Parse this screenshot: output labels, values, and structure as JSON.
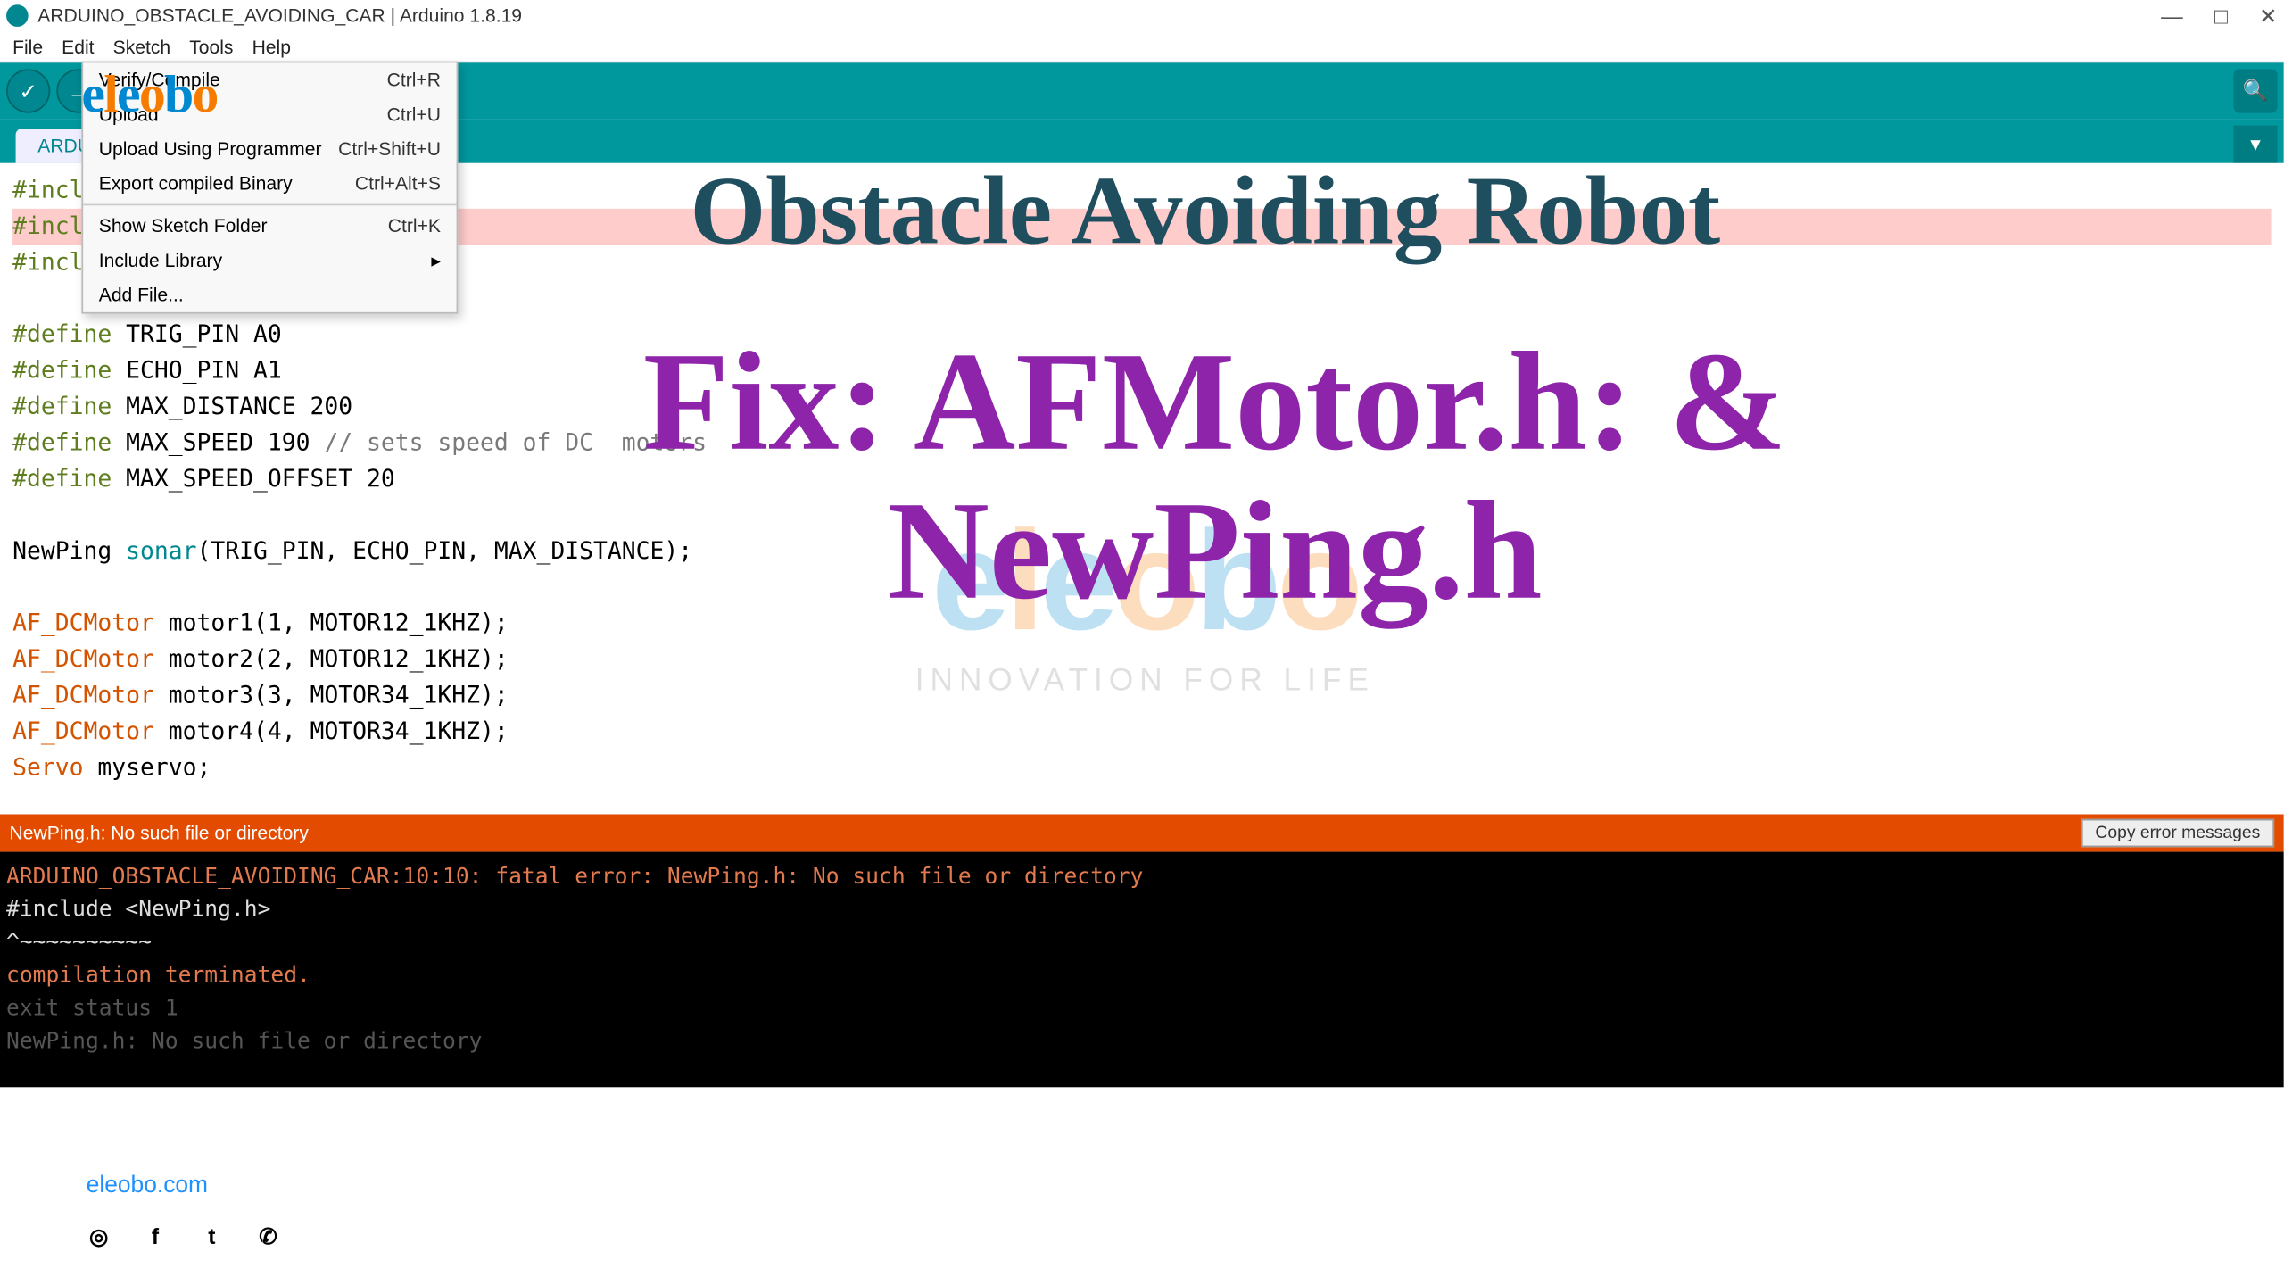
{
  "window": {
    "title": "ARDUINO_OBSTACLE_AVOIDING_CAR | Arduino 1.8.19"
  },
  "menubar": {
    "items": [
      "File",
      "Edit",
      "Sketch",
      "Tools",
      "Help"
    ]
  },
  "tab": {
    "name": "ARDUI"
  },
  "dropdown": {
    "items": [
      {
        "label": "Verify/Compile",
        "shortcut": "Ctrl+R"
      },
      {
        "label": "Upload",
        "shortcut": "Ctrl+U"
      },
      {
        "label": "Upload Using Programmer",
        "shortcut": "Ctrl+Shift+U"
      },
      {
        "label": "Export compiled Binary",
        "shortcut": "Ctrl+Alt+S"
      },
      {
        "label": "Show Sketch Folder",
        "shortcut": "Ctrl+K"
      },
      {
        "label": "Include Library",
        "shortcut": "",
        "submenu": true
      },
      {
        "label": "Add File...",
        "shortcut": ""
      }
    ]
  },
  "code": {
    "lines": [
      "#include",
      "#include <NewPing.h>",
      "#include <Servo.h>",
      "",
      "#define TRIG_PIN A0",
      "#define ECHO_PIN A1",
      "#define MAX_DISTANCE 200",
      "#define MAX_SPEED 190 // sets speed of DC  motors",
      "#define MAX_SPEED_OFFSET 20",
      "",
      "NewPing sonar(TRIG_PIN, ECHO_PIN, MAX_DISTANCE);",
      "",
      "AF_DCMotor motor1(1, MOTOR12_1KHZ);",
      "AF_DCMotor motor2(2, MOTOR12_1KHZ);",
      "AF_DCMotor motor3(3, MOTOR34_1KHZ);",
      "AF_DCMotor motor4(4, MOTOR34_1KHZ);",
      "Servo myservo;"
    ]
  },
  "status": {
    "message": "NewPing.h: No such file or directory",
    "copy_button": "Copy error messages"
  },
  "console": {
    "lines": [
      "ARDUINO_OBSTACLE_AVOIDING_CAR:10:10: fatal error: NewPing.h: No such file or directory",
      " #include <NewPing.h>",
      "          ^~~~~~~~~~~",
      "compilation terminated.",
      "exit status 1",
      "NewPing.h: No such file or directory"
    ]
  },
  "overlay": {
    "title": "Obstacle Avoiding Robot",
    "fix_line1": "Fix: AFMotor.h: &",
    "fix_line2": "NewPing.h",
    "watermark_tag": "INNOVATION FOR LIFE",
    "url": "eleobo.com"
  }
}
